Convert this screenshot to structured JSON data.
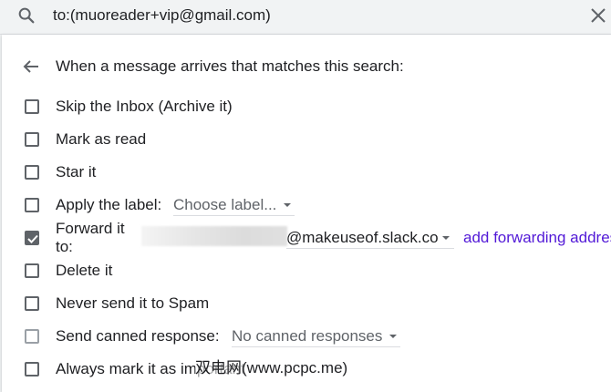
{
  "search": {
    "query": "to:(muoreader+vip@gmail.com)"
  },
  "filter": {
    "header": "When a message arrives that matches this search:",
    "options": [
      {
        "label": "Skip the Inbox (Archive it)",
        "checked": false
      },
      {
        "label": "Mark as read",
        "checked": false
      },
      {
        "label": "Star it",
        "checked": false
      },
      {
        "label": "Apply the label:",
        "checked": false,
        "dropdown": "Choose label..."
      },
      {
        "label_line1": "Forward it",
        "label_line2": "to:",
        "checked": true,
        "address_suffix": "@makeuseof.slack.co",
        "link": "add forwarding address"
      },
      {
        "label": "Delete it",
        "checked": false
      },
      {
        "label": "Never send it to Spam",
        "checked": false
      },
      {
        "label": "Send canned response:",
        "checked": false,
        "dropdown": "No canned responses"
      },
      {
        "label": "Always mark it as important",
        "checked": false
      }
    ]
  },
  "watermark": "双电网(www.pcpc.me)",
  "colors": {
    "link": "#5219d7",
    "checkbox": "#5f6368"
  }
}
